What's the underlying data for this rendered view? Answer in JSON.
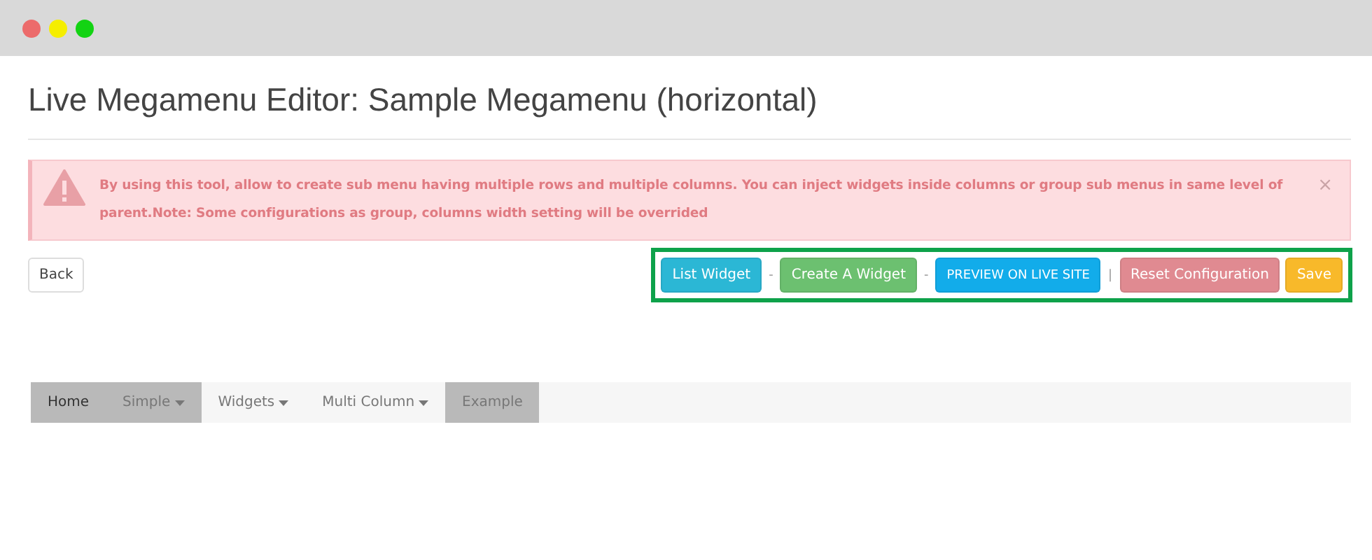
{
  "page_title": "Live Megamenu Editor: Sample Megamenu (horizontal)",
  "alert": {
    "message": "By using this tool, allow to create sub menu having multiple rows and multiple columns. You can inject widgets inside columns or group sub menus in same level of parent.Note: Some configurations as group, columns width setting will be overrided",
    "close": "×"
  },
  "back_button": "Back",
  "toolbar": [
    {
      "kind": "info",
      "label": "List Widget"
    },
    {
      "kind": "separator",
      "label": "-"
    },
    {
      "kind": "success",
      "label": "Create A Widget"
    },
    {
      "kind": "separator",
      "label": "-"
    },
    {
      "kind": "primary",
      "label": "PREVIEW ON LIVE SITE"
    },
    {
      "kind": "separator",
      "label": "|"
    },
    {
      "kind": "danger",
      "label": "Reset Configuration"
    },
    {
      "kind": "warning",
      "label": "Save"
    }
  ],
  "menu": [
    {
      "label": "Home",
      "highlighted": true,
      "selected": true,
      "dropdown": false
    },
    {
      "label": "Simple",
      "highlighted": true,
      "selected": false,
      "dropdown": true
    },
    {
      "label": "Widgets",
      "highlighted": false,
      "selected": false,
      "dropdown": true
    },
    {
      "label": "Multi Column",
      "highlighted": false,
      "selected": false,
      "dropdown": true
    },
    {
      "label": "Example",
      "highlighted": true,
      "selected": false,
      "dropdown": false
    }
  ]
}
